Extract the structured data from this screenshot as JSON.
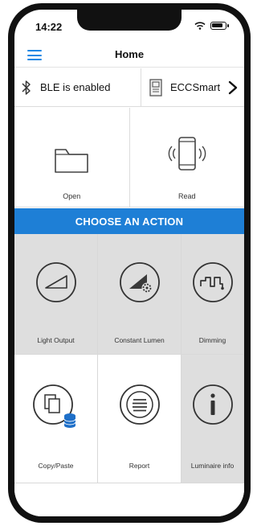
{
  "status": {
    "time": "14:22"
  },
  "nav": {
    "title": "Home"
  },
  "info": {
    "ble_label": "BLE is enabled",
    "device_label": "ECCSmart"
  },
  "top_actions": [
    {
      "label": "Open",
      "icon": "folder-icon"
    },
    {
      "label": "Read",
      "icon": "phone-read-icon"
    }
  ],
  "banner": {
    "text": "CHOOSE AN ACTION"
  },
  "tiles": [
    {
      "label": "Light Output",
      "icon": "light-output-icon"
    },
    {
      "label": "Constant Lumen",
      "icon": "constant-lumen-icon"
    },
    {
      "label": "Dimming",
      "icon": "dimming-icon"
    },
    {
      "label": "Copy/Paste",
      "icon": "copy-paste-icon"
    },
    {
      "label": "Report",
      "icon": "report-icon"
    },
    {
      "label": "Luminaire info",
      "icon": "info-icon"
    }
  ],
  "colors": {
    "accent": "#1e7fd6",
    "tile_gray": "#dedede",
    "hamburger": "#1e88e5",
    "database_badge": "#1e6fc8"
  }
}
